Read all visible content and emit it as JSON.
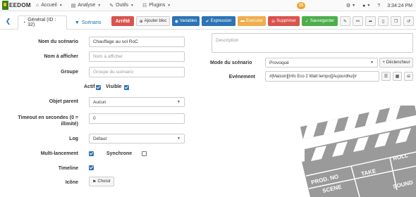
{
  "nav": {
    "logo_text": "EEDOM",
    "menu": [
      {
        "icon": "home-icon",
        "label": "Accueil"
      },
      {
        "icon": "chart-icon",
        "label": "Analyse"
      },
      {
        "icon": "wrench-icon",
        "label": "Outils"
      },
      {
        "icon": "tasks-icon",
        "label": "Plugins"
      }
    ],
    "badge": "15",
    "time": "3:34:24 PM"
  },
  "toolbar": {
    "tab_general": "Général (ID : 32)",
    "tab_scenario": "Scénario",
    "arret": "Arrêté",
    "ajouter_bloc": "Ajouter bloc",
    "variables": "Variables",
    "expression": "Expression",
    "executer": "Exécuter",
    "supprimer": "Supprimer",
    "sauvegarder": "Sauvegarder"
  },
  "form": {
    "nom_label": "Nom du scénario",
    "nom_value": "Chauffage au sol RoC",
    "afficher_label": "Nom à afficher",
    "afficher_placeholder": "Nom à afficher",
    "groupe_label": "Groupe",
    "groupe_placeholder": "Groupe du scénario",
    "actif_label": "Actif",
    "visible_label": "Visible",
    "objet_label": "Objet parent",
    "objet_value": "Aucun",
    "timeout_label": "Timeout en secondes (0 = illimité)",
    "timeout_value": "0",
    "log_label": "Log",
    "log_value": "Défaut",
    "multi_label": "Multi-lancement",
    "synchrone_label": "Synchrone",
    "timeline_label": "Timeline",
    "icone_label": "Icône",
    "choisir": "Choisir"
  },
  "right": {
    "description_placeholder": "Description",
    "mode_label": "Mode du scénario",
    "mode_value": "Provoqué",
    "declencheur": "Déclencheur",
    "evenement_label": "Evénement",
    "evenement_value": "#[Maison][Info Eco 2 Watt tempo][Aujourdhui]#"
  },
  "clapper": {
    "row1": "PROD. NO",
    "row1b": "SCENE",
    "row1c": "TAKE",
    "row2": "ROLL",
    "row3": "SOUND"
  },
  "colors": {
    "primary": "#2d74b4",
    "danger": "#d9534f",
    "warning": "#f0ad4e",
    "success": "#4cae4c"
  }
}
